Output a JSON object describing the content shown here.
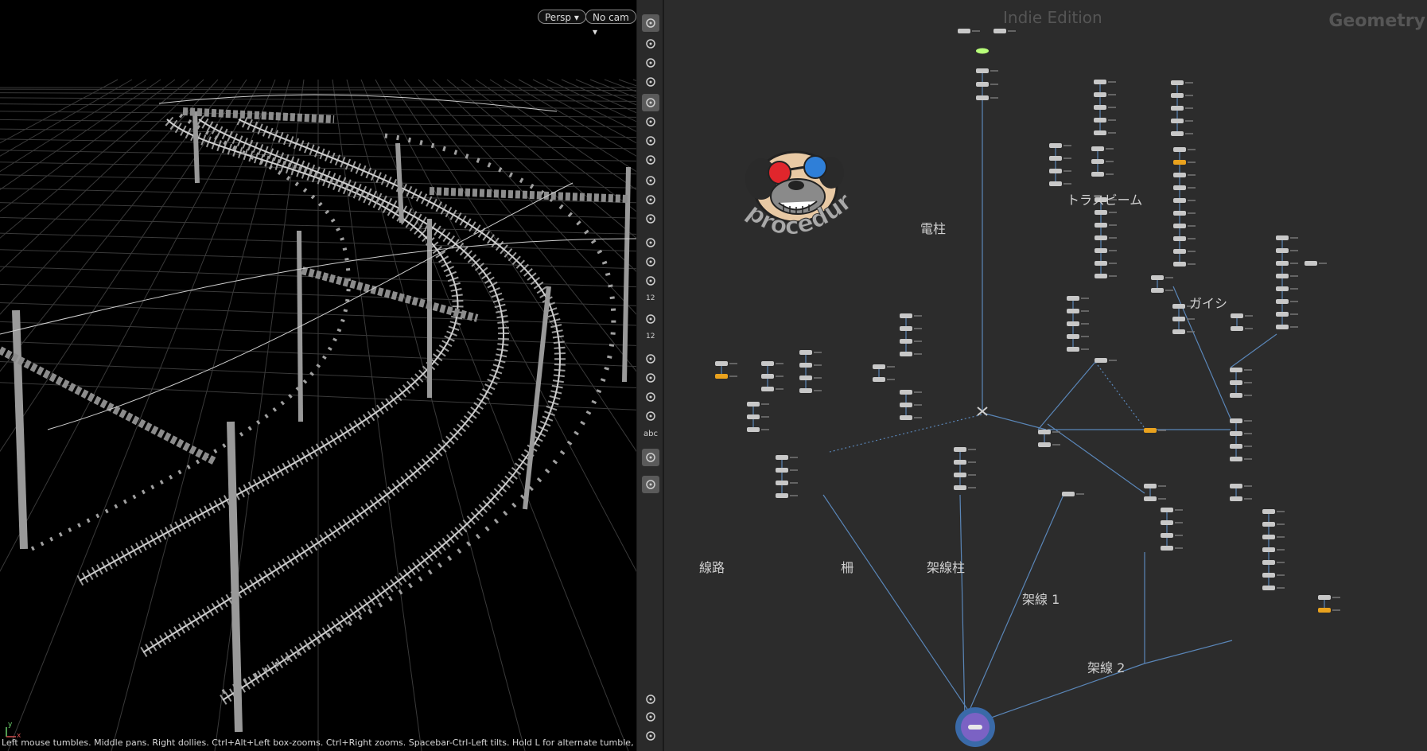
{
  "viewport": {
    "view_menu": "Persp",
    "camera_menu": "No cam",
    "status_text": "Left mouse tumbles. Middle pans. Right dollies. Ctrl+Alt+Left box-zooms. Ctrl+Right zooms. Spacebar-Ctrl-Left tilts. Hold L for alternate tumble, dolly, and zoom.",
    "axis_y": "y",
    "axis_x": "x"
  },
  "toolstrip": {
    "text_tool": "abc",
    "counter_a": "12",
    "counter_b": "12",
    "tools": [
      "select-icon",
      "move-icon",
      "lock-icon",
      "snap-icon",
      "view-icon",
      "light-icon",
      "bulb-icon",
      "skull-icon",
      "render-icon",
      "camera-icon",
      "camera2-icon",
      "point-icon",
      "pen-icon",
      "dropper-icon",
      "measure-icon",
      "brush-icon",
      "paint-icon",
      "corner-icon",
      "grid-icon",
      "branch-icon",
      "box-icon",
      "text-icon",
      "image-icon",
      "pin-icon",
      "info-icon",
      "tiles-icon",
      "eye-icon"
    ]
  },
  "network": {
    "edition": "Indie Edition",
    "context": "Geometry",
    "logo_text": "procedural",
    "labels": {
      "track": "線路",
      "fence": "柵",
      "catenary_pole": "架線柱",
      "wire1": "架線 1",
      "wire2": "架線 2",
      "utility_pole": "電柱",
      "truss_beam": "トラスビーム",
      "insulator": "ガイシ"
    }
  },
  "colors": {
    "viewport_bg": "#000000",
    "network_bg": "#2c2c2c",
    "wire": "#5a86b8",
    "node": "#c8c8c8",
    "node_selected": "#e9a21e",
    "output_node": "#7b62c4",
    "display_flag": "#b8ff7a"
  }
}
